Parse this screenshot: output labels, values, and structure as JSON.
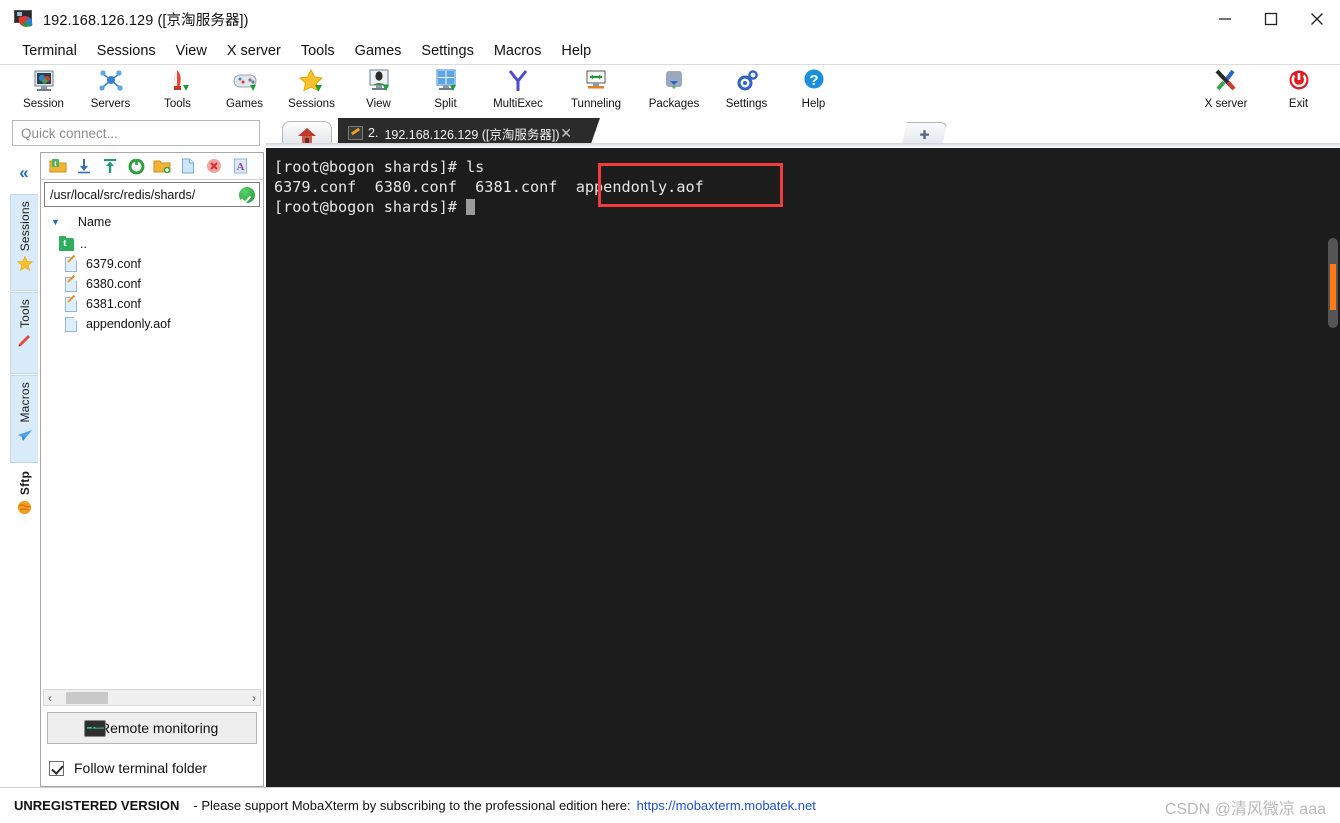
{
  "window": {
    "title": "192.168.126.129 ([京淘服务器])",
    "icon": "mobaxterm-logo-icon",
    "controls": {
      "minimize": "—",
      "maximize": "□",
      "close": "✕"
    }
  },
  "menubar": {
    "items": [
      "Terminal",
      "Sessions",
      "View",
      "X server",
      "Tools",
      "Games",
      "Settings",
      "Macros",
      "Help"
    ]
  },
  "toolbar": {
    "buttons": [
      {
        "label": "Session",
        "icon": "session-icon"
      },
      {
        "label": "Servers",
        "icon": "servers-icon"
      },
      {
        "label": "Tools",
        "icon": "tools-icon"
      },
      {
        "label": "Games",
        "icon": "games-icon"
      },
      {
        "label": "Sessions",
        "icon": "sessions-star-icon"
      },
      {
        "label": "View",
        "icon": "view-icon"
      },
      {
        "label": "Split",
        "icon": "split-icon"
      },
      {
        "label": "MultiExec",
        "icon": "multiexec-icon"
      },
      {
        "label": "Tunneling",
        "icon": "tunneling-icon"
      },
      {
        "label": "Packages",
        "icon": "packages-icon"
      },
      {
        "label": "Settings",
        "icon": "settings-gear-icon"
      },
      {
        "label": "Help",
        "icon": "help-icon"
      }
    ],
    "right_buttons": [
      {
        "label": "X server",
        "icon": "xserver-icon"
      },
      {
        "label": "Exit",
        "icon": "exit-power-icon"
      }
    ]
  },
  "quick_connect": {
    "placeholder": "Quick connect..."
  },
  "rail": {
    "collapse_icon": "double-chevron-left-icon",
    "tabs": [
      {
        "label": "Sessions",
        "icon": "star-icon"
      },
      {
        "label": "Tools",
        "icon": "knife-icon"
      },
      {
        "label": "Macros",
        "icon": "paper-plane-icon"
      },
      {
        "label": "Sftp",
        "icon": "globe-icon"
      }
    ]
  },
  "sftp": {
    "toolbar_icons": [
      "folder-up-icon",
      "download-icon",
      "upload-icon",
      "refresh-icon",
      "new-folder-icon",
      "new-file-icon",
      "delete-icon",
      "text-mode-icon"
    ],
    "path": "/usr/local/src/redis/shards/",
    "path_status_icon": "green-check-icon",
    "column_header": "Name",
    "sort_caret": "▼",
    "files": [
      {
        "name": "..",
        "icon": "folder-up-icon"
      },
      {
        "name": "6379.conf",
        "icon": "conf-file-icon"
      },
      {
        "name": "6380.conf",
        "icon": "conf-file-icon"
      },
      {
        "name": "6381.conf",
        "icon": "conf-file-icon"
      },
      {
        "name": "appendonly.aof",
        "icon": "plain-file-icon"
      }
    ],
    "hscroll": {
      "left_arrow": "‹",
      "right_arrow": "›"
    },
    "remote_monitoring": {
      "label": "Remote monitoring",
      "icon": "monitor-graph-icon"
    },
    "follow_terminal_folder": {
      "label": "Follow terminal folder",
      "checked": true
    }
  },
  "tabs": {
    "home_icon": "home-icon",
    "active": {
      "index_label": "2.",
      "title": "192.168.126.129 ([京淘服务器])",
      "icon": "ssh-key-icon",
      "close": "✕"
    },
    "new_tab_icon": "plus-icon"
  },
  "terminal": {
    "lines": [
      "[root@bogon shards]# ls",
      "6379.conf  6380.conf  6381.conf  appendonly.aof",
      "[root@bogon shards]# "
    ],
    "prompt_line_1": "[root@bogon shards]# ls",
    "line_2_left": "6379.conf  6380.conf  6381.conf  ",
    "line_2_highlight": "appendonly.aof",
    "prompt_line_3": "[root@bogon shards]# ",
    "highlight_color": "#f03c3c",
    "background": "#1c1c1c",
    "foreground": "#e6e6e6",
    "scrollbar_color": "#ff7a18",
    "clip_icon": "paperclip-icon"
  },
  "footer": {
    "badge": "UNREGISTERED VERSION",
    "message": "-  Please support MobaXterm by subscribing to the professional edition here:",
    "link": "https://mobaxterm.mobatek.net",
    "watermark": "CSDN @清风微凉 aaa"
  }
}
